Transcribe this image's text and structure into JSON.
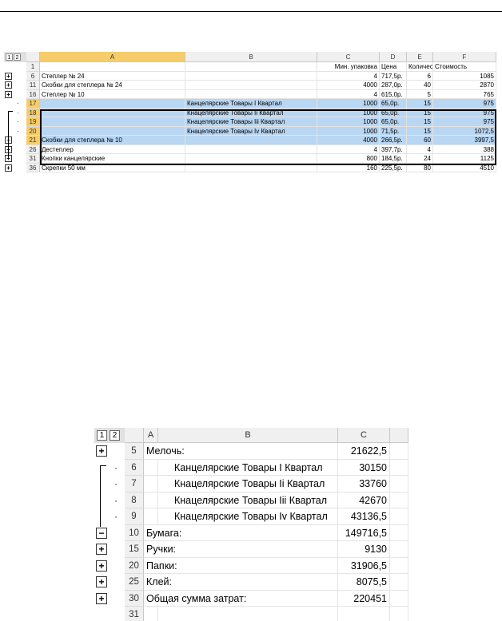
{
  "sheet1": {
    "level_buttons": [
      "1",
      "2"
    ],
    "columns": [
      "A",
      "B",
      "C",
      "D",
      "E",
      "F"
    ],
    "header_row": {
      "num": "1",
      "a": "",
      "b": "",
      "c": "Мин. упаковка",
      "d": "Цена",
      "e": "Количество",
      "f": "Стоимость"
    },
    "rows": [
      {
        "num": "6",
        "ctl": "+",
        "a": "Степлер № 24",
        "b": "",
        "c": "4",
        "d": "717,5р.",
        "e": "6",
        "f": "1085"
      },
      {
        "num": "11",
        "ctl": "+",
        "a": "Скобки для степлера № 24",
        "b": "",
        "c": "4000",
        "d": "287,0р.",
        "e": "40",
        "f": "2870"
      },
      {
        "num": "16",
        "ctl": "+",
        "a": "Степлер № 10",
        "b": "",
        "c": "4",
        "d": "615,0р.",
        "e": "5",
        "f": "765"
      },
      {
        "num": "17",
        "ctl": "·",
        "a": "",
        "b": "Канцелярские Товары I Квартал",
        "c": "1000",
        "d": "65,0р.",
        "e": "15",
        "f": "975"
      },
      {
        "num": "18",
        "ctl": "·",
        "a": "",
        "b": "Кнацелярские Товары Ii Квартал",
        "c": "1000",
        "d": "65,0р.",
        "e": "15",
        "f": "975"
      },
      {
        "num": "19",
        "ctl": "·",
        "a": "",
        "b": "Кнацелярские Товары Iii Квартал",
        "c": "1000",
        "d": "65,0р.",
        "e": "15",
        "f": "975"
      },
      {
        "num": "20",
        "ctl": "·",
        "a": "",
        "b": "Кнацелярские Товары Iv Квартал",
        "c": "1000",
        "d": "71,5р.",
        "e": "15",
        "f": "1072,5"
      },
      {
        "num": "21",
        "ctl": "−",
        "a": "Скобки для степлера № 10",
        "b": "",
        "c": "4000",
        "d": "266,5р.",
        "e": "60",
        "f": "3997,5"
      },
      {
        "num": "26",
        "ctl": "+",
        "a": "Дестеплер",
        "b": "",
        "c": "4",
        "d": "397,7р.",
        "e": "4",
        "f": "388"
      },
      {
        "num": "31",
        "ctl": "+",
        "a": "Кнопки канцелярские",
        "b": "",
        "c": "800",
        "d": "184,5р.",
        "e": "24",
        "f": "1125"
      },
      {
        "num": "36",
        "ctl": "+",
        "a": "Скрепки 50 мм",
        "b": "",
        "c": "160",
        "d": "225,5р.",
        "e": "80",
        "f": "4510"
      }
    ]
  },
  "sheet2": {
    "level_buttons": [
      "1",
      "2"
    ],
    "columns": [
      "A",
      "B",
      "C"
    ],
    "rows": [
      {
        "num": "5",
        "ctl": "+",
        "a": "Мелочь:",
        "b": "",
        "c": "21622,5"
      },
      {
        "num": "6",
        "ctl": "·",
        "a": "",
        "b": "Канцелярские Товары I Квартал",
        "c": "30150"
      },
      {
        "num": "7",
        "ctl": "·",
        "a": "",
        "b": "Кнацелярские Товары Ii Квартал",
        "c": "33760"
      },
      {
        "num": "8",
        "ctl": "·",
        "a": "",
        "b": "Кнацелярские Товары Iii Квартал",
        "c": "42670"
      },
      {
        "num": "9",
        "ctl": "·",
        "a": "",
        "b": "Кнацелярские Товары Iv Квартал",
        "c": "43136,5"
      },
      {
        "num": "10",
        "ctl": "−",
        "a": "Бумага:",
        "b": "",
        "c": "149716,5"
      },
      {
        "num": "15",
        "ctl": "+",
        "a": "Ручки:",
        "b": "",
        "c": "9130"
      },
      {
        "num": "20",
        "ctl": "+",
        "a": "Папки:",
        "b": "",
        "c": "31906,5"
      },
      {
        "num": "25",
        "ctl": "+",
        "a": "Клей:",
        "b": "",
        "c": "8075,5"
      },
      {
        "num": "30",
        "ctl": "+",
        "a": "Общая сумма затрат:",
        "b": "",
        "c": "220451"
      },
      {
        "num": "31",
        "ctl": "",
        "a": "",
        "b": "",
        "c": ""
      }
    ]
  }
}
